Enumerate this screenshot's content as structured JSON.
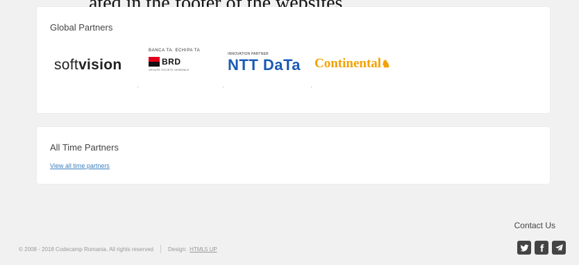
{
  "top_text": "ated in the footer of the websites.",
  "global_partners": {
    "title": "Global Partners",
    "logos": {
      "softvision": {
        "part1": "soft",
        "part2": "vision"
      },
      "brd": {
        "tagline": "BANCA TA. ECHIPA TA",
        "name": "BRD",
        "sub": "GROUPE SOCIETE GENERALE"
      },
      "ntt": {
        "tagline": "INNOVATION PARTNER",
        "name": "NTT DaTa"
      },
      "continental": {
        "name": "Continental"
      }
    }
  },
  "all_time_partners": {
    "title": "All Time Partners",
    "link": "View all time partners"
  },
  "footer": {
    "contact_title": "Contact Us",
    "copyright": "© 2008 - 2018 Codecamp Romania. All rights reserved",
    "design_label": "Design:",
    "design_link": "HTML5 UP"
  }
}
